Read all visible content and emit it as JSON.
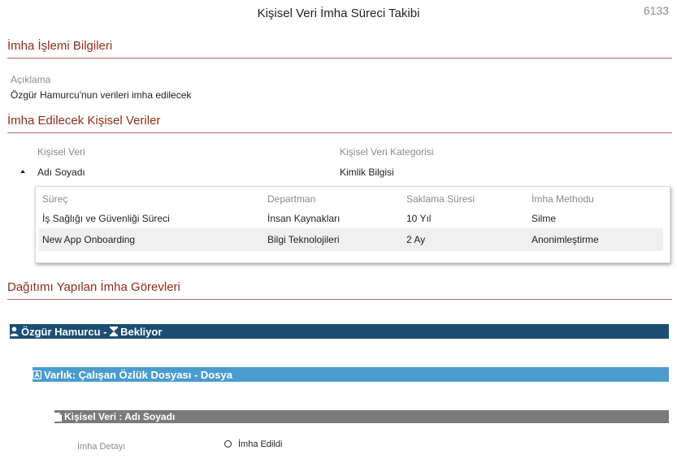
{
  "header": {
    "title": "Kişisel Veri İmha Süreci Takibi",
    "record_id": "6133"
  },
  "section_info": {
    "title": "İmha İşlemi Bilgileri",
    "description_label": "Açıklama",
    "description_value": "Özgür Hamurcu'nun verileri imha edilecek"
  },
  "section_data": {
    "title": "İmha Edilecek Kişisel Veriler",
    "col_data_label": "Kişisel Veri",
    "col_category_label": "Kişisel Veri Kategorisi",
    "row": {
      "data": "Adı Soyadı",
      "category": "Kimlik Bilgisi"
    },
    "detail": {
      "headers": [
        "Süreç",
        "Departman",
        "Saklama Süresi",
        "İmha Methodu"
      ],
      "rows": [
        [
          "İş Sağlığı ve Güvenliği Süreci",
          "İnsan Kaynakları",
          "10 Yıl",
          "Silme"
        ],
        [
          "New App Onboarding",
          "Bilgi Teknolojileri",
          "2 Ay",
          "Anonimleştirme"
        ]
      ]
    }
  },
  "section_tasks": {
    "title": "Dağıtımı Yapılan İmha Görevleri",
    "user_bar": {
      "name": "Özgür Hamurcu",
      "sep": " - ",
      "status": "Bekliyor",
      "icon": "user-icon",
      "status_icon": "hourglass-icon"
    },
    "asset_bar": {
      "text": "Varlık: Çalışan Özlük Dosyası - Dosya",
      "icon": "asset-icon"
    },
    "data_bar": {
      "text": "Kişisel Veri : Adı Soyadı",
      "icon": "file-icon"
    },
    "detail_label": "İmha Detayı",
    "detail_option": "İmha Edildi"
  },
  "colors": {
    "section_title": "#8b2e1a",
    "user_bar": "#1b4f72",
    "asset_bar": "#4a9ccf",
    "data_bar": "#7a7a7a"
  }
}
